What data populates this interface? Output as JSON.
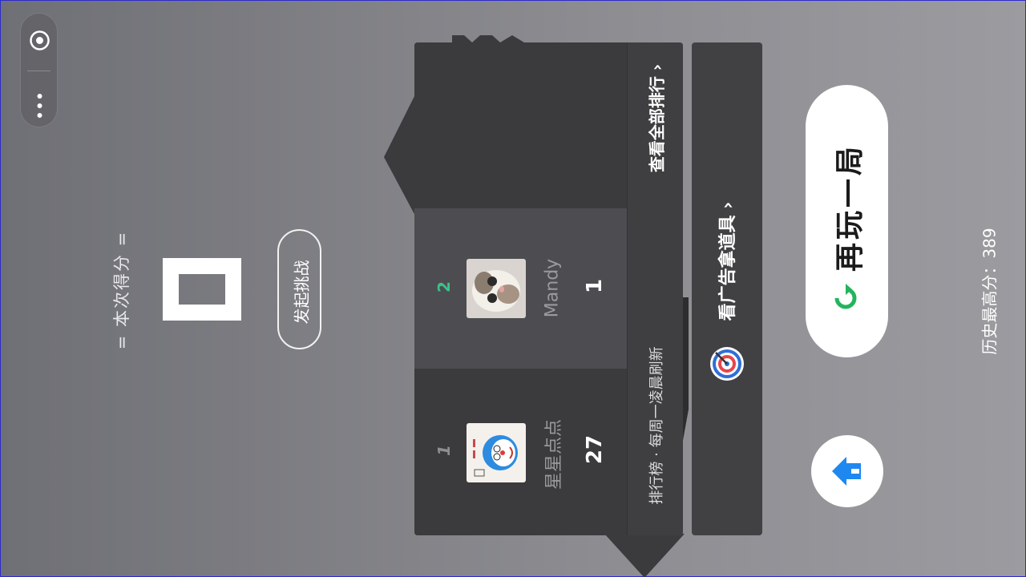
{
  "capsule": {
    "target_icon": "target-icon",
    "more_icon": "more-dots-icon"
  },
  "score": {
    "label": "= 本次得分 =",
    "value": "0"
  },
  "challenge": {
    "label": "发起挑战"
  },
  "leaderboard": {
    "rows": [
      {
        "rank": "1",
        "name": "星星点点",
        "score": "27",
        "avatar": "doraemon-avatar"
      },
      {
        "rank": "2",
        "name": "Mandy",
        "score": "1",
        "avatar": "cat-avatar"
      }
    ],
    "footer_note": "排行榜 · 每周一凌晨刷新",
    "view_all": "查看全部排行 ›"
  },
  "ad": {
    "label": "看广告拿道具 ›",
    "icon": "target-prop-icon"
  },
  "play_again": {
    "label": "再玩一局",
    "icon": "refresh-icon"
  },
  "home": {
    "icon": "home-icon"
  },
  "best_score": "历史最高分：389",
  "colors": {
    "rank1": "#8e8e91",
    "rank2": "#3ac28a",
    "accent_blue": "#1e88f0",
    "refresh_green": "#22b55b"
  }
}
